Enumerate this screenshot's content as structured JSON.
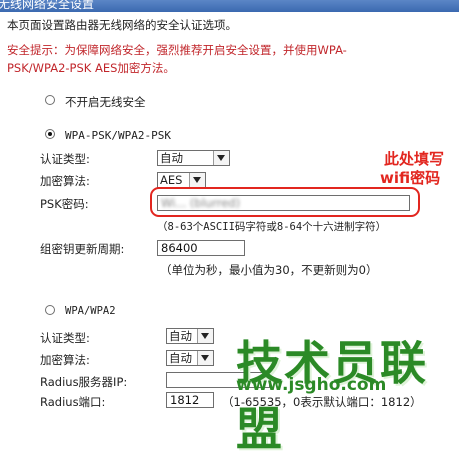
{
  "title": "无线网络安全设置",
  "intro": "本页面设置路由器无线网络的安全认证选项。",
  "tip_line1": "安全提示：为保障网络安全，强烈推荐开启安全设置，并使用WPA-",
  "tip_line2": "PSK/WPA2-PSK AES加密方法。",
  "opt_none": {
    "label": "不开启无线安全",
    "selected": false
  },
  "opt_psk": {
    "label": "WPA-PSK/WPA2-PSK",
    "selected": true
  },
  "psk": {
    "auth_label": "认证类型:",
    "auth_value": "自动",
    "enc_label": "加密算法:",
    "enc_value": "AES",
    "pwd_label": "PSK密码:",
    "pwd_value": "Wi... (blurred)",
    "pwd_hint": "（8-63个ASCII码字符或8-64个十六进制字符）",
    "group_label": "组密钥更新周期:",
    "group_value": "86400",
    "group_hint": "（单位为秒，最小值为30，不更新则为0）"
  },
  "annotation": {
    "line1": "此处填写",
    "line2": "wifi密码"
  },
  "opt_wpa": {
    "label": "WPA/WPA2",
    "selected": false
  },
  "wpa": {
    "auth_label": "认证类型:",
    "auth_value": "自动",
    "enc_label": "加密算法:",
    "enc_value": "自动",
    "radius_ip_label": "Radius服务器IP:",
    "radius_port_label": "Radius端口:",
    "radius_port_value": "1812",
    "radius_port_hint": "（1-65535，0表示默认端口：1812）"
  },
  "watermark": {
    "brand": "技术员联盟",
    "url": "www.jsgho.com"
  },
  "colors": {
    "accent_red": "#e2261f",
    "tip_red": "#c1262b",
    "titlebar": "#3b69b0",
    "watermark_green": "#2b8a26"
  }
}
